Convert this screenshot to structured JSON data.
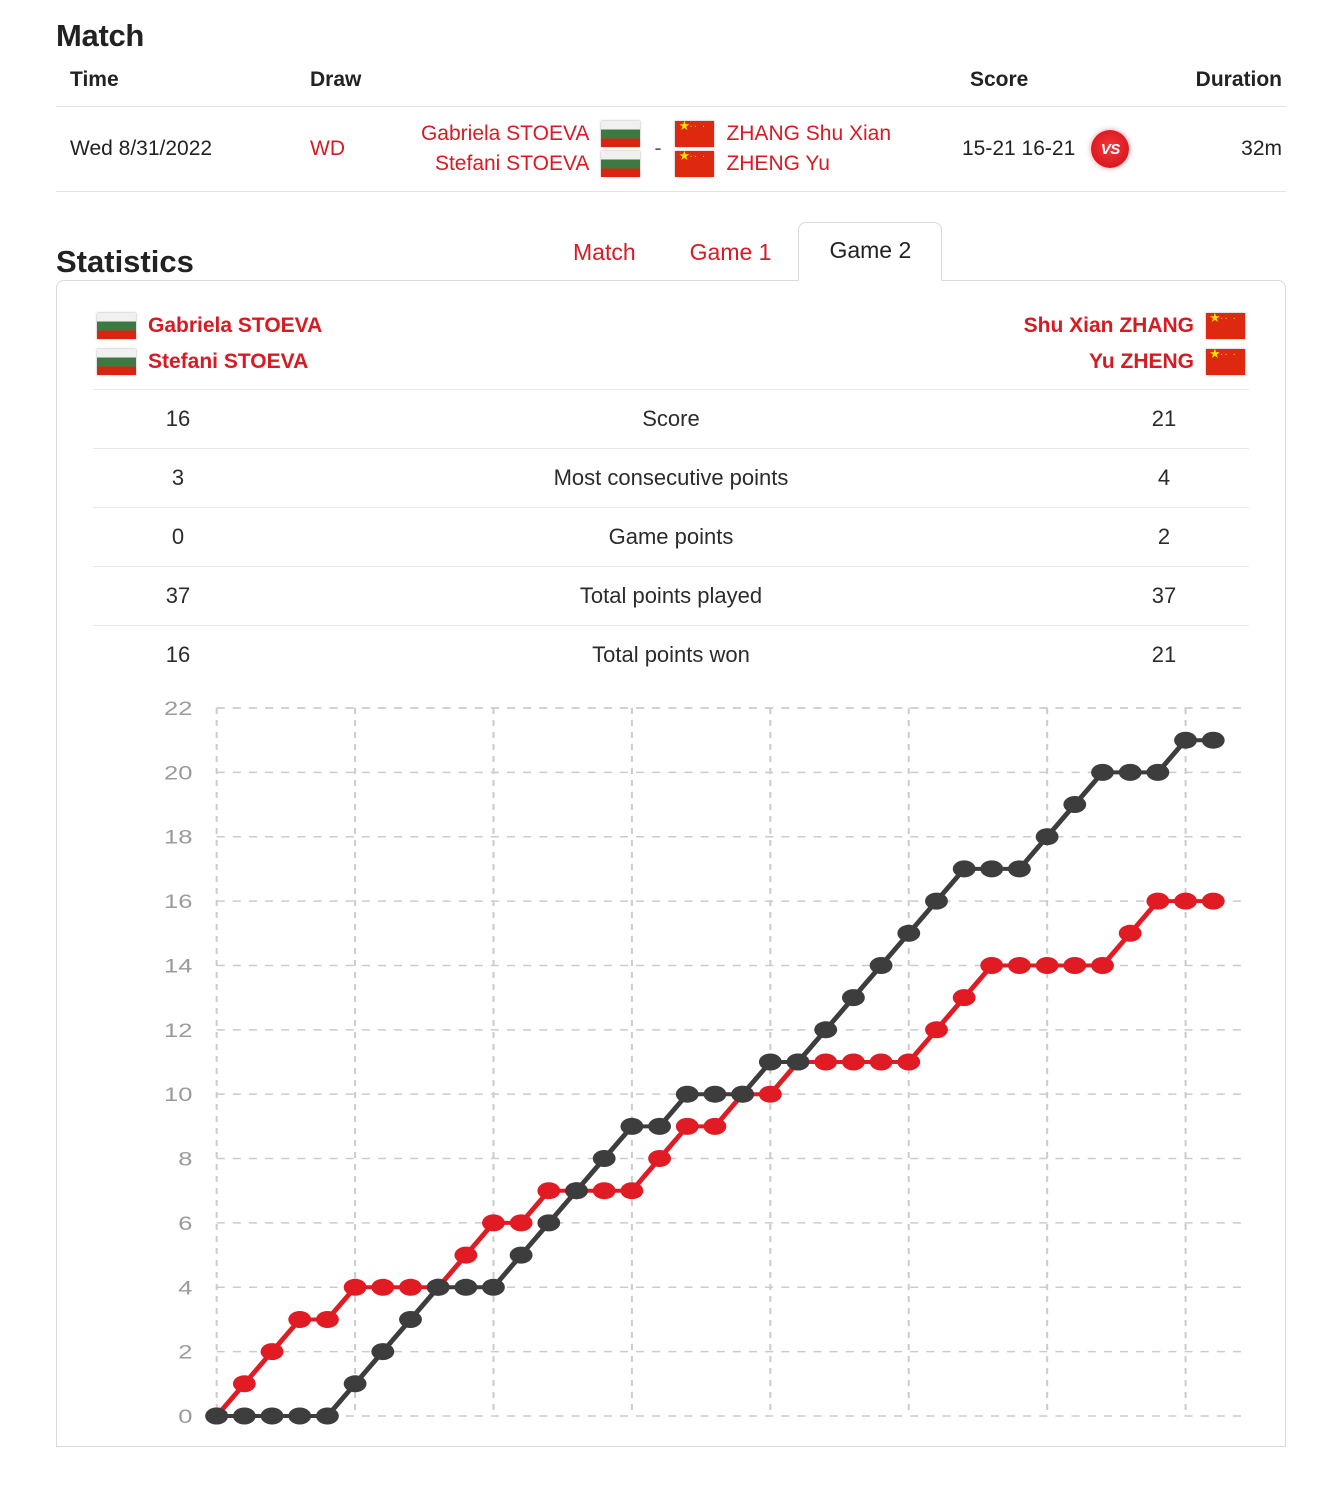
{
  "match": {
    "title": "Match",
    "columns": {
      "time": "Time",
      "draw": "Draw",
      "score": "Score",
      "duration": "Duration"
    },
    "row": {
      "date": "Wed 8/31/2022",
      "draw": "WD",
      "team_left": {
        "p1": "Gabriela STOEVA",
        "p2": "Stefani STOEVA",
        "flag": "bulgaria-flag"
      },
      "separator": "-",
      "team_right": {
        "p1": "ZHANG Shu Xian",
        "p2": "ZHENG Yu",
        "flag": "china-flag"
      },
      "score": "15-21 16-21",
      "vs_badge": "VS",
      "duration": "32m"
    }
  },
  "statistics": {
    "title": "Statistics",
    "tabs": [
      {
        "label": "Match",
        "active": false
      },
      {
        "label": "Game 1",
        "active": false
      },
      {
        "label": "Game 2",
        "active": true
      }
    ],
    "team_left": {
      "p1": "Gabriela STOEVA",
      "p2": "Stefani STOEVA",
      "flag": "bulgaria-flag"
    },
    "team_right": {
      "p1": "Shu Xian ZHANG",
      "p2": "Yu ZHENG",
      "flag": "china-flag"
    },
    "rows": [
      {
        "left": "16",
        "label": "Score",
        "right": "21"
      },
      {
        "left": "3",
        "label": "Most consecutive points",
        "right": "4"
      },
      {
        "left": "0",
        "label": "Game points",
        "right": "2"
      },
      {
        "left": "37",
        "label": "Total points played",
        "right": "37"
      },
      {
        "left": "16",
        "label": "Total points won",
        "right": "21"
      }
    ]
  },
  "chart_data": {
    "type": "line",
    "title": "",
    "xlabel": "",
    "ylabel": "",
    "ylim": [
      0,
      22
    ],
    "yticks": [
      0,
      2,
      4,
      6,
      8,
      10,
      12,
      14,
      16,
      18,
      20,
      22
    ],
    "grid": true,
    "legend": "none",
    "x": [
      0,
      1,
      2,
      3,
      4,
      5,
      6,
      7,
      8,
      9,
      10,
      11,
      12,
      13,
      14,
      15,
      16,
      17,
      18,
      19,
      20,
      21,
      22,
      23,
      24,
      25,
      26,
      27,
      28,
      29,
      30,
      31,
      32,
      33,
      34,
      35,
      36
    ],
    "xlim": [
      0,
      37
    ],
    "series": [
      {
        "name": "Gabriela STOEVA / Stefani STOEVA",
        "color": "#e01b24",
        "values": [
          0,
          1,
          2,
          3,
          3,
          4,
          4,
          4,
          4,
          5,
          6,
          6,
          7,
          7,
          7,
          7,
          8,
          9,
          9,
          10,
          10,
          11,
          11,
          11,
          11,
          11,
          12,
          13,
          14,
          14,
          14,
          14,
          14,
          15,
          16,
          16,
          16
        ]
      },
      {
        "name": "Shu Xian ZHANG / Yu ZHENG",
        "color": "#3d3d3d",
        "values": [
          0,
          0,
          0,
          0,
          0,
          1,
          2,
          3,
          4,
          4,
          4,
          5,
          6,
          7,
          8,
          9,
          9,
          10,
          10,
          10,
          11,
          11,
          12,
          13,
          14,
          15,
          16,
          17,
          17,
          17,
          18,
          19,
          20,
          20,
          20,
          21,
          21
        ]
      }
    ]
  },
  "colors": {
    "accent_red": "#d81a23",
    "series_red": "#e01b24",
    "series_dark": "#3d3d3d",
    "grid": "#cccccc",
    "tick_text": "#9b9b9b"
  }
}
